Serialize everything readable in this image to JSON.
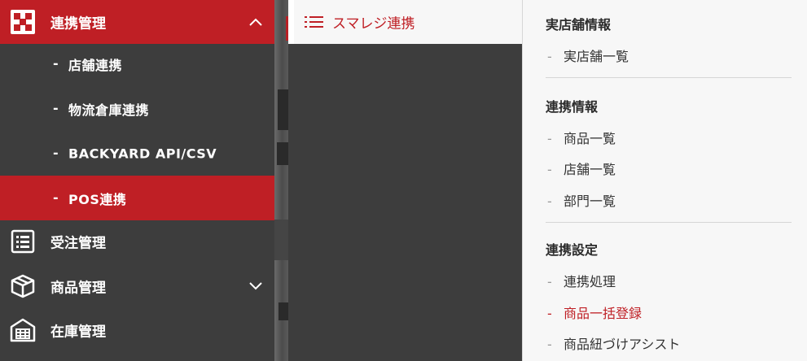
{
  "sidebar": {
    "integration": {
      "label": "連携管理"
    },
    "submenu": [
      {
        "label": "店舗連携"
      },
      {
        "label": "物流倉庫連携"
      },
      {
        "label": "BACKYARD API/CSV"
      },
      {
        "label": "POS連携"
      }
    ],
    "orders": {
      "label": "受注管理"
    },
    "products": {
      "label": "商品管理"
    },
    "inventory": {
      "label": "在庫管理"
    },
    "dash": "-"
  },
  "middle": {
    "header_label": "スマレジ連携"
  },
  "panel": {
    "dash": "-",
    "sections": [
      {
        "title": "実店舗情報",
        "links": [
          {
            "label": "実店舗一覧"
          }
        ]
      },
      {
        "title": "連携情報",
        "links": [
          {
            "label": "商品一覧"
          },
          {
            "label": "店舗一覧"
          },
          {
            "label": "部門一覧"
          }
        ]
      },
      {
        "title": "連携設定",
        "links": [
          {
            "label": "連携処理"
          },
          {
            "label": "商品一括登録"
          },
          {
            "label": "商品紐づけアシスト"
          }
        ]
      }
    ]
  },
  "colors": {
    "accent": "#bf1f25",
    "sidebar_bg": "#3d3d3d",
    "panel_bg": "#f7f7f7"
  }
}
